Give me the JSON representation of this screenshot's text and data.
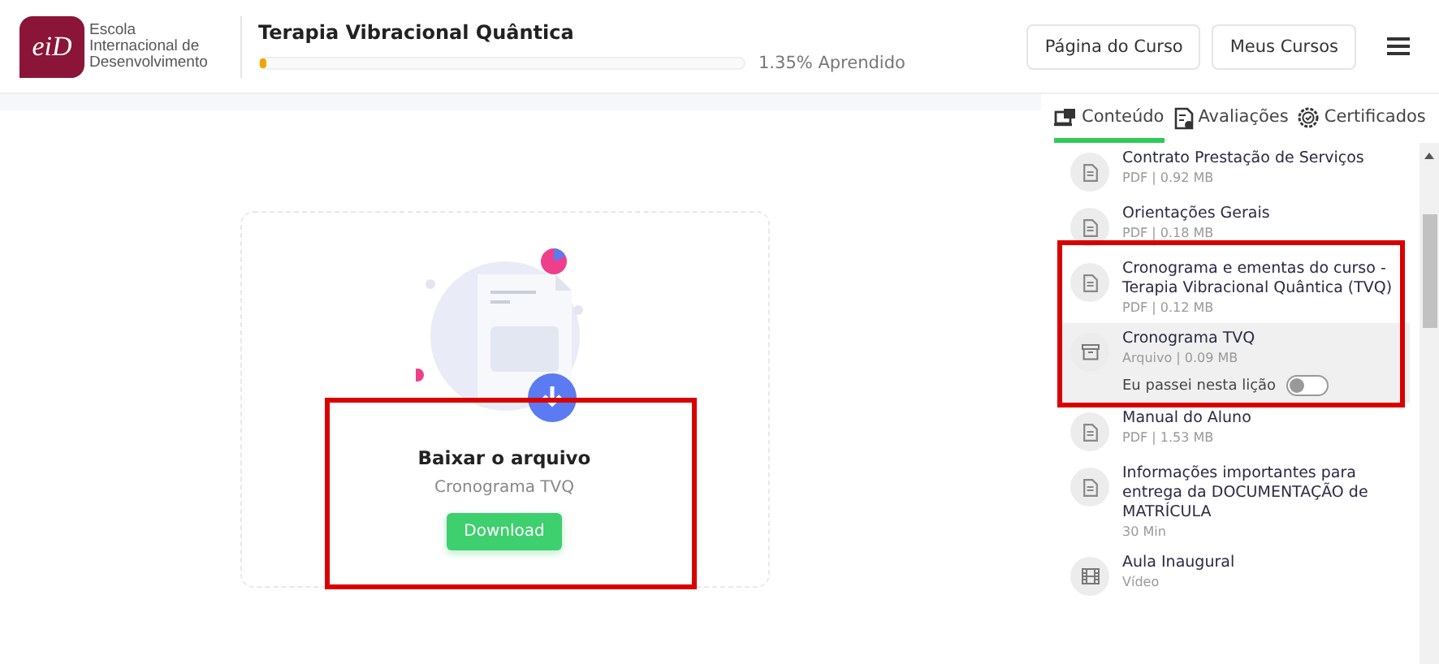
{
  "header": {
    "logo_mark": "eiD",
    "logo_text": [
      "Escola",
      "Internacional de",
      "Desenvolvimento"
    ],
    "course_title": "Terapia Vibracional Quântica",
    "progress": {
      "level": 0.0135,
      "reading": "1.35% Aprendido"
    },
    "buttons": [
      "Página do Curso",
      "Meus Cursos"
    ]
  },
  "download_card": {
    "title": "Baixar o arquivo",
    "file_name": "Cronograma TVQ",
    "button": "Download"
  },
  "sidebar": {
    "tabs": [
      {
        "label": "Conteúdo",
        "kind": "content",
        "selected": true
      },
      {
        "label": "Avaliações",
        "kind": "exam",
        "selected": false
      },
      {
        "label": "Certificados",
        "kind": "certificate",
        "selected": false
      }
    ],
    "items": [
      {
        "title": "Contrato Prestação de Serviços",
        "meta": "PDF | 0.92 MB",
        "kind": "document",
        "selected": false
      },
      {
        "title": "Orientações Gerais",
        "meta": "PDF | 0.18 MB",
        "kind": "document",
        "selected": false
      },
      {
        "title": "Cronograma e ementas do curso - Terapia Vibracional Quântica (TVQ)",
        "meta": "PDF | 0.12 MB",
        "kind": "document",
        "selected": false
      },
      {
        "title": "Cronograma TVQ",
        "meta": "Arquivo | 0.09 MB",
        "kind": "archive",
        "selected": true,
        "completion": {
          "label": "Eu passei nesta lição",
          "on": false
        }
      },
      {
        "title": "Manual do Aluno",
        "meta": "PDF | 1.53 MB",
        "kind": "document",
        "selected": false
      },
      {
        "title": "Informações importantes para entrega da DOCUMENTAÇÃO de MATRÍCULA",
        "meta": "30 Min",
        "kind": "document",
        "selected": false
      },
      {
        "title": "Aula Inaugural",
        "meta": "Vídeo",
        "kind": "video",
        "selected": false
      }
    ]
  }
}
